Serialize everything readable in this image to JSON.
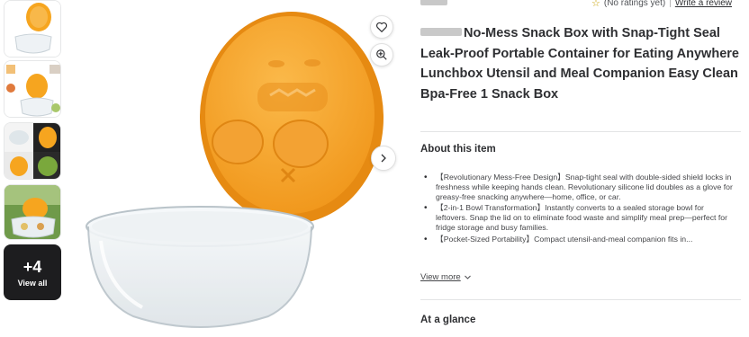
{
  "thumbnails": {
    "more_count": "+4",
    "view_all_label": "View all"
  },
  "rating": {
    "text": "(No ratings yet)",
    "write_review_label": "Write a review"
  },
  "product": {
    "title": "No-Mess Snack Box with Snap-Tight Seal Leak-Proof Portable Container for Eating Anywhere Lunchbox Utensil and Meal Companion Easy Clean Bpa-Free 1 Snack Box"
  },
  "about": {
    "heading": "About this item",
    "bullets": [
      "【Revolutionary Mess-Free Design】Snap-tight seal with double-sided shield locks in freshness while keeping hands clean. Revolutionary silicone lid doubles as a glove for greasy-free snacking anywhere—home, office, or car.",
      "【2-in-1 Bowl Transformation】Instantly converts to a sealed storage bowl for leftovers. Snap the lid on to eliminate food waste and simplify meal prep—perfect for fridge storage and busy families.",
      "【Pocket-Sized Portability】Compact utensil-and-meal companion fits in..."
    ],
    "view_more_label": "View more"
  },
  "at_a_glance": {
    "heading": "At a glance"
  },
  "colors": {
    "lid_orange": "#f5a623",
    "text_dark": "#2e2f32",
    "divider": "#e3e4e5"
  },
  "icons": [
    "heart-icon",
    "zoom-in-icon",
    "chevron-right-icon",
    "star-outline-icon",
    "chevron-down-icon"
  ]
}
